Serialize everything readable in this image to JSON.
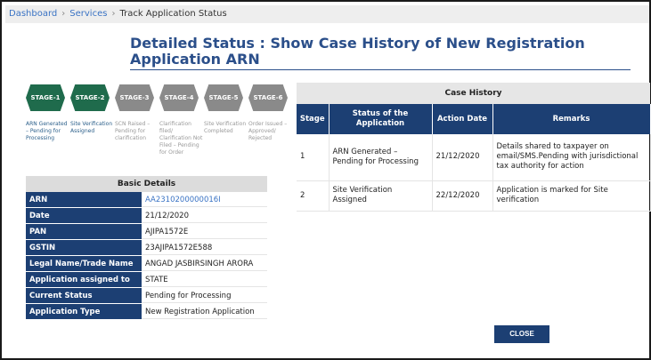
{
  "breadcrumb": {
    "items": [
      "Dashboard",
      "Services"
    ],
    "current": "Track Application Status",
    "separator": "›"
  },
  "page": {
    "title": "Detailed Status : Show Case History of New Registration Application ARN"
  },
  "stages": [
    {
      "label": "STAGE-1",
      "state": "done",
      "desc": "ARN Generated – Pending for Processing"
    },
    {
      "label": "STAGE-2",
      "state": "done",
      "desc": "Site Verification Assigned"
    },
    {
      "label": "STAGE-3",
      "state": "pending",
      "desc": "SCN Raised – Pending for clarification"
    },
    {
      "label": "STAGE-4",
      "state": "pending",
      "desc": "Clarification filed/ Clarification Not Filed – Pending for Order"
    },
    {
      "label": "STAGE-5",
      "state": "pending",
      "desc": "Site Verification Completed"
    },
    {
      "label": "STAGE-6",
      "state": "pending",
      "desc": "Order Issued – Approved/ Rejected"
    }
  ],
  "basic_details": {
    "title": "Basic Details",
    "rows": [
      {
        "key": "ARN",
        "value": "AA2310200000016I",
        "link": true
      },
      {
        "key": "Date",
        "value": "21/12/2020"
      },
      {
        "key": "PAN",
        "value": "AJIPA1572E"
      },
      {
        "key": "GSTIN",
        "value": "23AJIPA1572E588"
      },
      {
        "key": "Legal Name/Trade Name",
        "value": "ANGAD JASBIRSINGH ARORA"
      },
      {
        "key": "Application assigned to",
        "value": "STATE"
      },
      {
        "key": "Current Status",
        "value": "Pending for Processing"
      },
      {
        "key": "Application Type",
        "value": "New Registration Application"
      }
    ]
  },
  "case_history": {
    "title": "Case History",
    "columns": [
      "Stage",
      "Status of the Application",
      "Action Date",
      "Remarks"
    ],
    "rows": [
      {
        "stage": "1",
        "status": "ARN Generated – Pending for Processing",
        "date": "21/12/2020",
        "remarks": "Details shared to taxpayer on email/SMS.Pending with jurisdictional tax authority for action"
      },
      {
        "stage": "2",
        "status": "Site Verification Assigned",
        "date": "22/12/2020",
        "remarks": "Application is marked for Site verification"
      }
    ]
  },
  "actions": {
    "close_label": "CLOSE"
  },
  "colors": {
    "navy": "#1c3f73",
    "stage_done": "#1f6b4c",
    "stage_pending": "#8a8a8a",
    "title": "#2b4f8a",
    "link": "#3a73c4"
  }
}
